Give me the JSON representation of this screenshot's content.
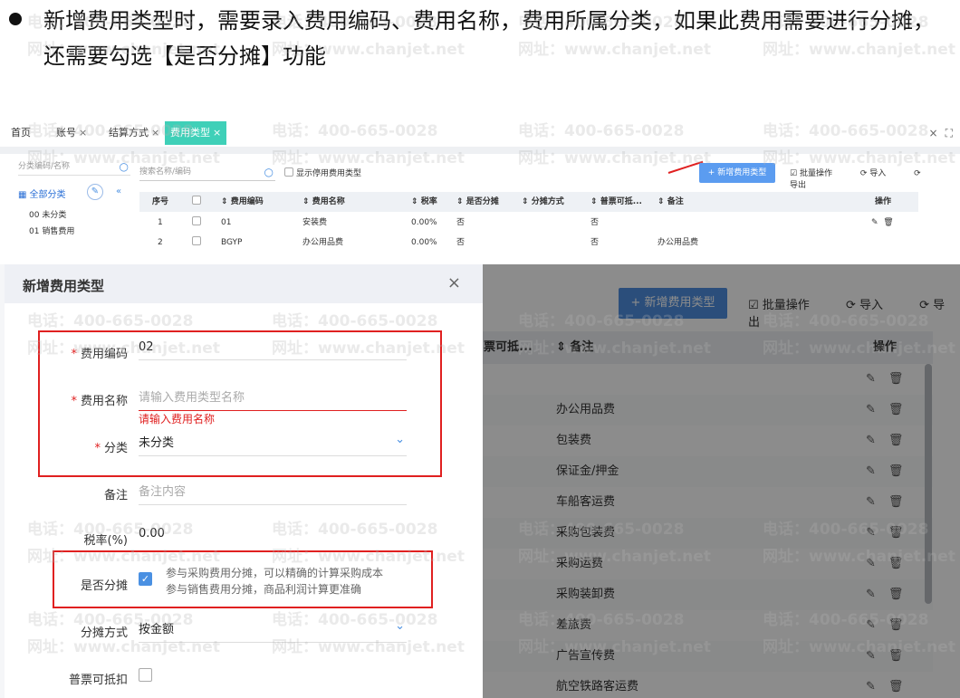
{
  "instruction": {
    "text": "新增费用类型时，需要录入费用编码、费用名称，费用所属分类，如果此费用需要进行分摊，还需要勾选【是否分摊】功能"
  },
  "upper": {
    "tabs": [
      {
        "label": "首页",
        "closable": false
      },
      {
        "label": "账号",
        "closable": true
      },
      {
        "label": "结算方式",
        "closable": true
      },
      {
        "label": "费用类型",
        "closable": true,
        "active": true
      }
    ],
    "close_symbol": "×",
    "left_pane": {
      "search_placeholder": "分类编码/名称",
      "all_label": "全部分类",
      "items": [
        "00 未分类",
        "01 销售费用"
      ]
    },
    "main": {
      "search_placeholder": "搜索名称/编码",
      "show_disabled_label": "显示停用费用类型",
      "add_button": "+ 新增费用类型",
      "batch_label": "批量操作",
      "import_label": "导入",
      "export_label": "导出",
      "columns": [
        "序号",
        "费用编码",
        "费用名称",
        "税率",
        "是否分摊",
        "分摊方式",
        "普票可抵...",
        "备注",
        "操作"
      ],
      "rows": [
        {
          "seq": "1",
          "code": "01",
          "name": "安装费",
          "tax": "0.00%",
          "share": "否",
          "method": "",
          "invoice": "否",
          "note": ""
        },
        {
          "seq": "2",
          "code": "BGYP",
          "name": "办公用品费",
          "tax": "0.00%",
          "share": "否",
          "method": "",
          "invoice": "否",
          "note": "办公用品费"
        }
      ]
    }
  },
  "lower": {
    "background": {
      "add_button": "+ 新增费用类型",
      "batch_label": "批量操作",
      "import_label": "导入",
      "export_label": "导出",
      "columns": {
        "invoice": "票可抵...",
        "note": "备注",
        "ops": "操作"
      },
      "notes": [
        "",
        "办公用品费",
        "包装费",
        "保证金/押金",
        "车船客运费",
        "采购包装费",
        "采购运费",
        "采购装卸费",
        "差旅费",
        "广告宣传费",
        "航空铁路客运费"
      ]
    },
    "dialog": {
      "title": "新增费用类型",
      "close_symbol": "×",
      "fields": {
        "code": {
          "label": "费用编码",
          "value": "02"
        },
        "name": {
          "label": "费用名称",
          "placeholder": "请输入费用类型名称",
          "error": "请输入费用名称"
        },
        "category": {
          "label": "分类",
          "value": "未分类"
        },
        "note": {
          "label": "备注",
          "placeholder": "备注内容"
        },
        "tax": {
          "label": "税率(%)",
          "value": "0.00"
        },
        "share": {
          "label": "是否分摊",
          "hint1": "参与采购费用分摊，可以精确的计算采购成本",
          "hint2": "参与销售费用分摊，商品利润计算更准确"
        },
        "method": {
          "label": "分摊方式",
          "value": "按金额"
        },
        "invoice": {
          "label": "普票可抵扣"
        }
      },
      "required_mark": "*"
    }
  },
  "watermark": {
    "phone": "电话：400-665-0028",
    "site": "网址：www.chanjet.net"
  },
  "colors": {
    "accent": "#4a90e2",
    "tab_active": "#3fd0b8",
    "error": "#e02020"
  }
}
